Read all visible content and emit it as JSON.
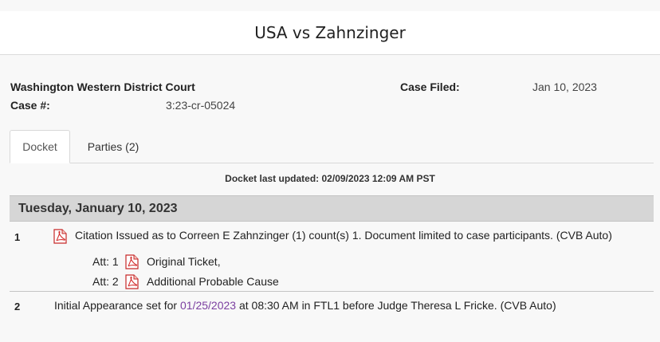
{
  "page_title": "USA vs Zahnzinger",
  "case_info": {
    "court": "Washington Western District Court",
    "case_number_label": "Case #:",
    "case_number": "3:23-cr-05024",
    "case_filed_label": "Case Filed:",
    "case_filed": "Jan 10, 2023"
  },
  "tabs": [
    {
      "label": "Docket",
      "active": true
    },
    {
      "label": "Parties (2)",
      "active": false
    }
  ],
  "docket_updated": "Docket last updated: 02/09/2023 12:09 AM PST",
  "day_heading": "Tuesday, January 10, 2023",
  "entries": [
    {
      "number": "1",
      "text": "Citation Issued as to Correen E Zahnzinger (1) count(s) 1. Document limited to case participants. (CVB Auto)",
      "attachments": [
        {
          "label": "Att: 1",
          "name": "Original Ticket,"
        },
        {
          "label": "Att: 2",
          "name": "Additional Probable Cause"
        }
      ]
    },
    {
      "number": "2",
      "text_before": "Initial Appearance set for ",
      "link": "01/25/2023",
      "text_after": " at 08:30 AM in FTL1 before Judge Theresa L Fricke. (CVB Auto)"
    }
  ],
  "icons": {
    "pdf": "pdf-icon"
  },
  "colors": {
    "link": "#7b3fa0",
    "pdf_red": "#d32f2f",
    "day_bar": "#d6d6d6"
  }
}
